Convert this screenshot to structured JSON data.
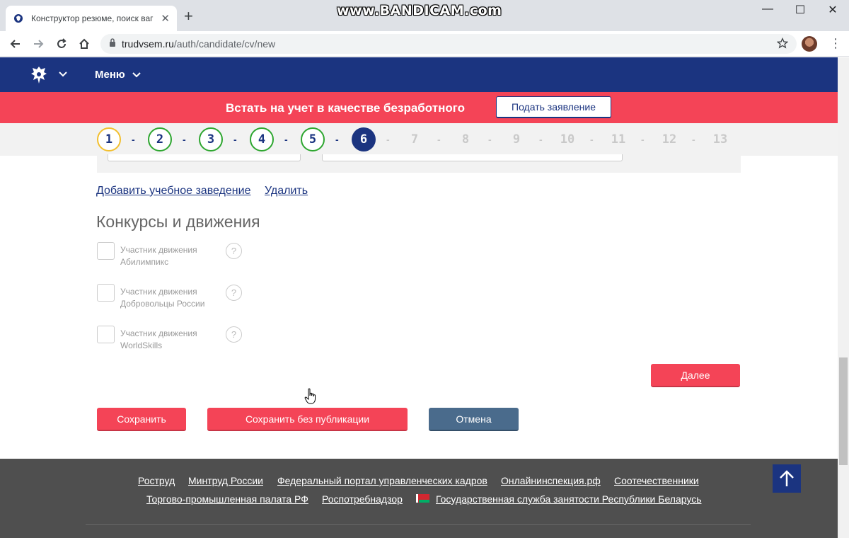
{
  "browser": {
    "tab_title": "Конструктор резюме, поиск ваг",
    "url_host": "trudvsem.ru",
    "url_path": "/auth/candidate/cv/new",
    "watermark": "www.BANDICAM.com"
  },
  "header": {
    "menu_label": "Меню"
  },
  "banner": {
    "text": "Встать на учет в качестве безработного",
    "button_label": "Подать заявление"
  },
  "steps": {
    "items": [
      "1",
      "2",
      "3",
      "4",
      "5",
      "6",
      "7",
      "8",
      "9",
      "10",
      "11",
      "12",
      "13"
    ],
    "current": 6
  },
  "education": {
    "add_link": "Добавить учебное заведение",
    "delete_link": "Удалить"
  },
  "contests": {
    "title": "Конкурсы и движения",
    "items": [
      {
        "label": "Участник движения Абилимпикс"
      },
      {
        "label": "Участник движения Добровольцы России"
      },
      {
        "label": "Участник движения WorldSkills"
      }
    ],
    "help_glyph": "?"
  },
  "actions": {
    "next_label": "Далее",
    "save_label": "Сохранить",
    "save_no_publish_label": "Сохранить без публикации",
    "cancel_label": "Отмена"
  },
  "footer": {
    "row1": [
      "Роструд",
      "Минтруд России",
      "Федеральный портал управленческих кадров",
      "Онлайнинспекция.рф",
      "Соотечественники"
    ],
    "row2": [
      "Торгово-промышленная палата РФ",
      "Роспотребнадзор",
      "Государственная служба занятости Республики Беларусь"
    ]
  },
  "colors": {
    "brand_blue": "#1b3480",
    "accent_red": "#f44457",
    "step_done_green": "#2da62f",
    "step_first_yellow": "#f2bf2e"
  }
}
